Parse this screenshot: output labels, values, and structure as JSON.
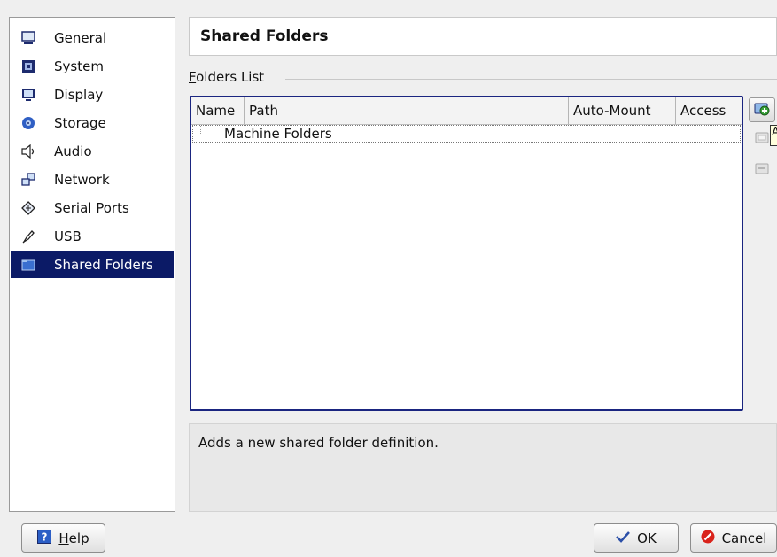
{
  "sidebar": {
    "items": [
      {
        "label": "General",
        "icon": "monitor-icon"
      },
      {
        "label": "System",
        "icon": "chip-icon"
      },
      {
        "label": "Display",
        "icon": "display-icon"
      },
      {
        "label": "Storage",
        "icon": "disk-icon"
      },
      {
        "label": "Audio",
        "icon": "speaker-icon"
      },
      {
        "label": "Network",
        "icon": "network-icon"
      },
      {
        "label": "Serial Ports",
        "icon": "serial-port-icon"
      },
      {
        "label": "USB",
        "icon": "usb-icon"
      },
      {
        "label": "Shared Folders",
        "icon": "folder-icon",
        "selected": true
      }
    ]
  },
  "header": {
    "title": "Shared Folders"
  },
  "folders": {
    "group_label_first": "F",
    "group_label_rest": "olders List",
    "columns": [
      "Name",
      "Path",
      "Auto-Mount",
      "Access"
    ],
    "rows": [
      {
        "name": "Machine Folders"
      }
    ]
  },
  "toolbar": {
    "add_icon": "add-folder-icon",
    "edit_icon": "edit-folder-icon",
    "remove_icon": "remove-folder-icon",
    "tooltip_fragment": "A"
  },
  "description": "Adds a new shared folder definition.",
  "footer": {
    "help_first": "H",
    "help_rest": "elp",
    "ok_label": "OK",
    "cancel_label": "Cancel"
  },
  "colors": {
    "selection": "#0b1a66",
    "list_border": "#1a2580",
    "cancel_red": "#d9231b",
    "ok_blue": "#2b4fa8"
  }
}
